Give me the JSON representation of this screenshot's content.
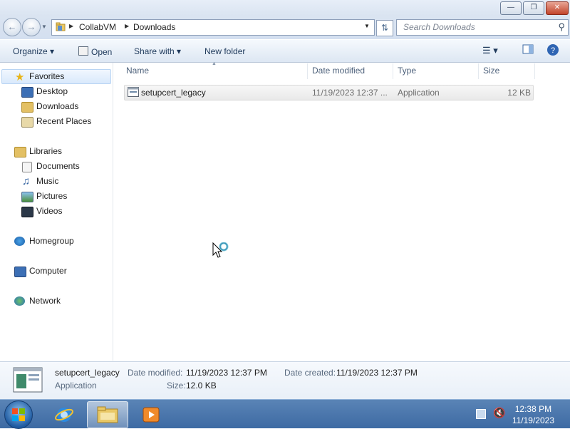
{
  "address": {
    "parts": [
      "CollabVM",
      "Downloads"
    ]
  },
  "search": {
    "placeholder": "Search Downloads"
  },
  "toolbar": {
    "organize": "Organize",
    "open": "Open",
    "share_with": "Share with",
    "new_folder": "New folder"
  },
  "sidebar": {
    "favorites": {
      "label": "Favorites",
      "items": [
        "Desktop",
        "Downloads",
        "Recent Places"
      ]
    },
    "libraries": {
      "label": "Libraries",
      "items": [
        "Documents",
        "Music",
        "Pictures",
        "Videos"
      ]
    },
    "homegroup": "Homegroup",
    "computer": "Computer",
    "network": "Network"
  },
  "columns": [
    "Name",
    "Date modified",
    "Type",
    "Size"
  ],
  "files": [
    {
      "name": "setupcert_legacy",
      "date_modified": "11/19/2023 12:37 ...",
      "type": "Application",
      "size": "12 KB"
    }
  ],
  "details": {
    "name": "setupcert_legacy",
    "type": "Application",
    "date_modified_label": "Date modified:",
    "date_modified": "11/19/2023 12:37 PM",
    "date_created_label": "Date created:",
    "date_created": "11/19/2023 12:37 PM",
    "size_label": "Size:",
    "size": "12.0 KB"
  },
  "clock": {
    "time": "12:38 PM",
    "date": "11/19/2023"
  }
}
